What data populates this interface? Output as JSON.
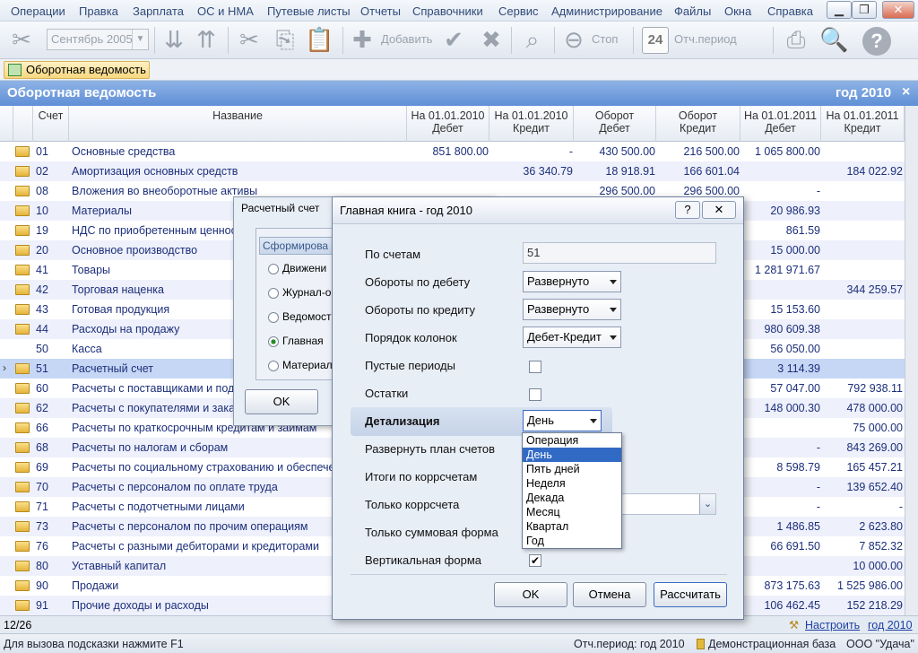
{
  "menu": [
    "Операции",
    "Правка",
    "Зарплата",
    "ОС и НМА",
    "Путевые листы",
    "Отчеты",
    "Справочники",
    "Сервис",
    "Администрирование",
    "Файлы",
    "Окна",
    "Справка"
  ],
  "toolbar": {
    "period": "Сентябрь 2005",
    "add": "Добавить",
    "stop": "Стоп",
    "report_period": "Отч.период",
    "cal_day": "24"
  },
  "tab": {
    "label": "Оборотная ведомость"
  },
  "window": {
    "title": "Оборотная ведомость",
    "year": "год 2010",
    "close": "×"
  },
  "grid": {
    "headers": [
      [
        "Счет",
        ""
      ],
      [
        "Название",
        ""
      ],
      [
        "На 01.01.2010",
        "Дебет"
      ],
      [
        "На 01.01.2010",
        "Кредит"
      ],
      [
        "Оборот",
        "Дебет"
      ],
      [
        "Оборот",
        "Кредит"
      ],
      [
        "На 01.01.2011",
        "Дебет"
      ],
      [
        "На 01.01.2011",
        "Кредит"
      ]
    ],
    "rows": [
      [
        "01",
        "Основные средства",
        "851 800.00",
        "-",
        "430 500.00",
        "216 500.00",
        "1 065 800.00",
        ""
      ],
      [
        "02",
        "Амортизация основных средств",
        "",
        "36 340.79",
        "18 918.91",
        "166 601.04",
        "",
        "184 022.92"
      ],
      [
        "08",
        "Вложения во внеоборотные активы",
        "",
        "",
        "296 500.00",
        "296 500.00",
        "-",
        ""
      ],
      [
        "10",
        "Материалы",
        "",
        "",
        "",
        "",
        "20 986.93",
        ""
      ],
      [
        "19",
        "НДС по приобретенным ценностям",
        "",
        "",
        "",
        "",
        "861.59",
        ""
      ],
      [
        "20",
        "Основное производство",
        "",
        "",
        "",
        "",
        "15 000.00",
        ""
      ],
      [
        "41",
        "Товары",
        "",
        "",
        "",
        "",
        "1 281 971.67",
        ""
      ],
      [
        "42",
        "Торговая наценка",
        "",
        "",
        "",
        "",
        "",
        "344 259.57"
      ],
      [
        "43",
        "Готовая продукция",
        "",
        "",
        "",
        "",
        "15 153.60",
        ""
      ],
      [
        "44",
        "Расходы на продажу",
        "",
        "",
        "",
        "",
        "980 609.38",
        ""
      ],
      [
        "50",
        "Касса",
        "",
        "",
        "",
        "",
        "56 050.00",
        ""
      ],
      [
        "51",
        "Расчетный счет",
        "",
        "",
        "",
        "",
        "3 114.39",
        ""
      ],
      [
        "60",
        "Расчеты с поставщиками и подрядчиками",
        "",
        "",
        "",
        "",
        "57 047.00",
        "792 938.11"
      ],
      [
        "62",
        "Расчеты с покупателями и заказчиками",
        "",
        "",
        "",
        "",
        "148 000.30",
        "478 000.00"
      ],
      [
        "66",
        "Расчеты по краткосрочным кредитам и займам",
        "",
        "",
        "",
        "",
        "",
        "75 000.00"
      ],
      [
        "68",
        "Расчеты по налогам и сборам",
        "",
        "",
        "",
        "",
        "-",
        "843 269.00"
      ],
      [
        "69",
        "Расчеты по социальному страхованию и обеспечению",
        "",
        "",
        "",
        "",
        "8 598.79",
        "165 457.21"
      ],
      [
        "70",
        "Расчеты с персоналом по оплате труда",
        "",
        "",
        "",
        "",
        "-",
        "139 652.40"
      ],
      [
        "71",
        "Расчеты с подотчетными лицами",
        "",
        "",
        "",
        "",
        "-",
        "-"
      ],
      [
        "73",
        "Расчеты с персоналом по прочим операциям",
        "",
        "",
        "",
        "",
        "1 486.85",
        "2 623.80"
      ],
      [
        "76",
        "Расчеты с разными дебиторами и кредиторами",
        "",
        "",
        "",
        "",
        "66 691.50",
        "7 852.32"
      ],
      [
        "80",
        "Уставный капитал",
        "",
        "",
        "",
        "",
        "",
        "10 000.00"
      ],
      [
        "90",
        "Продажи",
        "",
        "",
        "",
        "",
        "873 175.63",
        "1 525 986.00"
      ],
      [
        "91",
        "Прочие доходы и расходы",
        "",
        "",
        "",
        "",
        "106 462.45",
        "152 218.29"
      ]
    ]
  },
  "footer": {
    "count": "12/26",
    "setup": "Настроить",
    "year": "год 2010"
  },
  "status": {
    "hint": "Для вызова подсказки нажмите F1",
    "period": "Отч.период: год 2010",
    "base": "Демонстрационная база",
    "org": "ООО \"Удача\""
  },
  "back_dialog": {
    "title": "Расчетный счет",
    "group": "Сформирова",
    "options": [
      "Движени",
      "Журнал-о",
      "Ведомост",
      "Главная",
      "Материал"
    ],
    "ok": "OK"
  },
  "dialog": {
    "title": "Главная книга - год 2010",
    "accounts_label": "По счетам",
    "accounts_value": "51",
    "debit_label": "Обороты по дебету",
    "debit_value": "Развернуто",
    "credit_label": "Обороты по кредиту",
    "credit_value": "Развернуто",
    "order_label": "Порядок колонок",
    "order_value": "Дебет-Кредит",
    "empty_label": "Пустые периоды",
    "balance_label": "Остатки",
    "detail_label": "Детализация",
    "detail_value": "День",
    "expand_label": "Развернуть план счетов",
    "totals_label": "Итоги по коррсчетам",
    "corr_label": "Только коррсчета",
    "sum_label": "Только суммовая форма",
    "vertical_label": "Вертикальная форма",
    "ok": "OK",
    "cancel": "Отмена",
    "calc": "Рассчитать",
    "options": [
      "Операция",
      "День",
      "Пять дней",
      "Неделя",
      "Декада",
      "Месяц",
      "Квартал",
      "Год"
    ]
  }
}
